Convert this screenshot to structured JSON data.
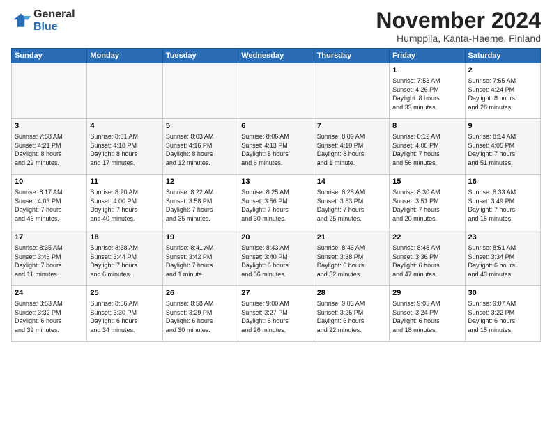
{
  "logo": {
    "general": "General",
    "blue": "Blue"
  },
  "title": "November 2024",
  "subtitle": "Humppila, Kanta-Haeme, Finland",
  "weekdays": [
    "Sunday",
    "Monday",
    "Tuesday",
    "Wednesday",
    "Thursday",
    "Friday",
    "Saturday"
  ],
  "weeks": [
    [
      {
        "day": "",
        "info": ""
      },
      {
        "day": "",
        "info": ""
      },
      {
        "day": "",
        "info": ""
      },
      {
        "day": "",
        "info": ""
      },
      {
        "day": "",
        "info": ""
      },
      {
        "day": "1",
        "info": "Sunrise: 7:53 AM\nSunset: 4:26 PM\nDaylight: 8 hours\nand 33 minutes."
      },
      {
        "day": "2",
        "info": "Sunrise: 7:55 AM\nSunset: 4:24 PM\nDaylight: 8 hours\nand 28 minutes."
      }
    ],
    [
      {
        "day": "3",
        "info": "Sunrise: 7:58 AM\nSunset: 4:21 PM\nDaylight: 8 hours\nand 22 minutes."
      },
      {
        "day": "4",
        "info": "Sunrise: 8:01 AM\nSunset: 4:18 PM\nDaylight: 8 hours\nand 17 minutes."
      },
      {
        "day": "5",
        "info": "Sunrise: 8:03 AM\nSunset: 4:16 PM\nDaylight: 8 hours\nand 12 minutes."
      },
      {
        "day": "6",
        "info": "Sunrise: 8:06 AM\nSunset: 4:13 PM\nDaylight: 8 hours\nand 6 minutes."
      },
      {
        "day": "7",
        "info": "Sunrise: 8:09 AM\nSunset: 4:10 PM\nDaylight: 8 hours\nand 1 minute."
      },
      {
        "day": "8",
        "info": "Sunrise: 8:12 AM\nSunset: 4:08 PM\nDaylight: 7 hours\nand 56 minutes."
      },
      {
        "day": "9",
        "info": "Sunrise: 8:14 AM\nSunset: 4:05 PM\nDaylight: 7 hours\nand 51 minutes."
      }
    ],
    [
      {
        "day": "10",
        "info": "Sunrise: 8:17 AM\nSunset: 4:03 PM\nDaylight: 7 hours\nand 46 minutes."
      },
      {
        "day": "11",
        "info": "Sunrise: 8:20 AM\nSunset: 4:00 PM\nDaylight: 7 hours\nand 40 minutes."
      },
      {
        "day": "12",
        "info": "Sunrise: 8:22 AM\nSunset: 3:58 PM\nDaylight: 7 hours\nand 35 minutes."
      },
      {
        "day": "13",
        "info": "Sunrise: 8:25 AM\nSunset: 3:56 PM\nDaylight: 7 hours\nand 30 minutes."
      },
      {
        "day": "14",
        "info": "Sunrise: 8:28 AM\nSunset: 3:53 PM\nDaylight: 7 hours\nand 25 minutes."
      },
      {
        "day": "15",
        "info": "Sunrise: 8:30 AM\nSunset: 3:51 PM\nDaylight: 7 hours\nand 20 minutes."
      },
      {
        "day": "16",
        "info": "Sunrise: 8:33 AM\nSunset: 3:49 PM\nDaylight: 7 hours\nand 15 minutes."
      }
    ],
    [
      {
        "day": "17",
        "info": "Sunrise: 8:35 AM\nSunset: 3:46 PM\nDaylight: 7 hours\nand 11 minutes."
      },
      {
        "day": "18",
        "info": "Sunrise: 8:38 AM\nSunset: 3:44 PM\nDaylight: 7 hours\nand 6 minutes."
      },
      {
        "day": "19",
        "info": "Sunrise: 8:41 AM\nSunset: 3:42 PM\nDaylight: 7 hours\nand 1 minute."
      },
      {
        "day": "20",
        "info": "Sunrise: 8:43 AM\nSunset: 3:40 PM\nDaylight: 6 hours\nand 56 minutes."
      },
      {
        "day": "21",
        "info": "Sunrise: 8:46 AM\nSunset: 3:38 PM\nDaylight: 6 hours\nand 52 minutes."
      },
      {
        "day": "22",
        "info": "Sunrise: 8:48 AM\nSunset: 3:36 PM\nDaylight: 6 hours\nand 47 minutes."
      },
      {
        "day": "23",
        "info": "Sunrise: 8:51 AM\nSunset: 3:34 PM\nDaylight: 6 hours\nand 43 minutes."
      }
    ],
    [
      {
        "day": "24",
        "info": "Sunrise: 8:53 AM\nSunset: 3:32 PM\nDaylight: 6 hours\nand 39 minutes."
      },
      {
        "day": "25",
        "info": "Sunrise: 8:56 AM\nSunset: 3:30 PM\nDaylight: 6 hours\nand 34 minutes."
      },
      {
        "day": "26",
        "info": "Sunrise: 8:58 AM\nSunset: 3:29 PM\nDaylight: 6 hours\nand 30 minutes."
      },
      {
        "day": "27",
        "info": "Sunrise: 9:00 AM\nSunset: 3:27 PM\nDaylight: 6 hours\nand 26 minutes."
      },
      {
        "day": "28",
        "info": "Sunrise: 9:03 AM\nSunset: 3:25 PM\nDaylight: 6 hours\nand 22 minutes."
      },
      {
        "day": "29",
        "info": "Sunrise: 9:05 AM\nSunset: 3:24 PM\nDaylight: 6 hours\nand 18 minutes."
      },
      {
        "day": "30",
        "info": "Sunrise: 9:07 AM\nSunset: 3:22 PM\nDaylight: 6 hours\nand 15 minutes."
      }
    ]
  ]
}
